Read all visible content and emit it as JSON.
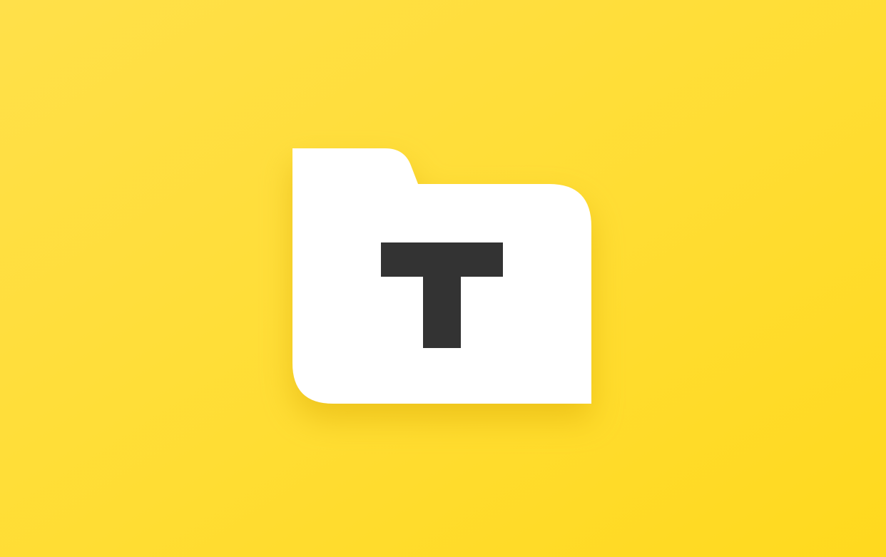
{
  "logo": {
    "name": "folder-t-logo",
    "glyph": "T",
    "colors": {
      "background_light": "#FFE04A",
      "background_main": "#FFDD33",
      "background_deep": "#FFD91E",
      "folder": "#FFFFFF",
      "glyph": "#333333",
      "shadow": "#D9A600"
    }
  }
}
